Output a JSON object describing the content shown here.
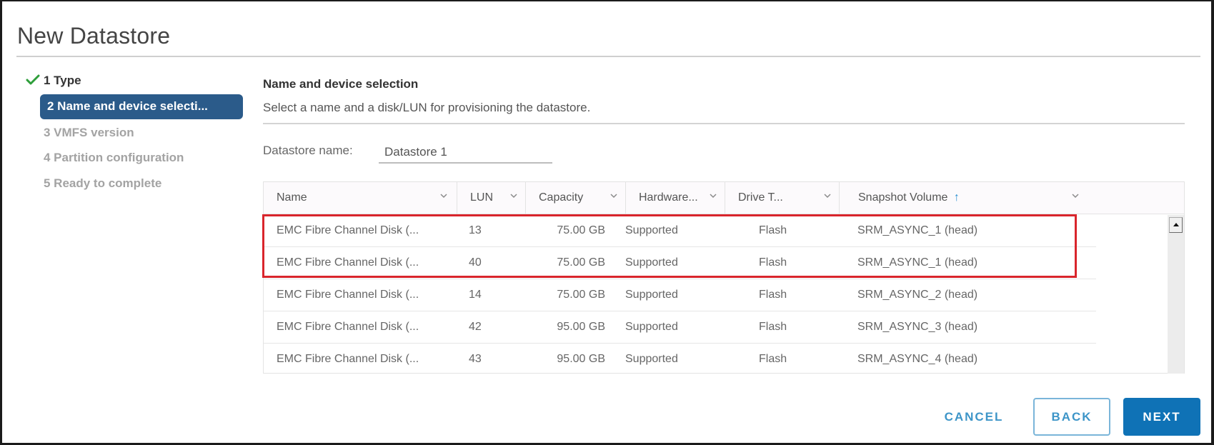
{
  "dialog": {
    "title": "New Datastore"
  },
  "wizard": {
    "steps": [
      {
        "label": "1 Type",
        "state": "completed"
      },
      {
        "label": "2 Name and device selecti...",
        "state": "active"
      },
      {
        "label": "3 VMFS version",
        "state": "pending"
      },
      {
        "label": "4 Partition configuration",
        "state": "pending"
      },
      {
        "label": "5 Ready to complete",
        "state": "pending"
      }
    ],
    "completed_icon": "checkmark-icon"
  },
  "content": {
    "heading": "Name and device selection",
    "subtitle": "Select a name and a disk/LUN for provisioning the datastore.",
    "datastore_name_label": "Datastore name:",
    "datastore_name_value": "Datastore 1"
  },
  "table": {
    "columns": [
      {
        "label": "Name"
      },
      {
        "label": "LUN"
      },
      {
        "label": "Capacity"
      },
      {
        "label": "Hardware..."
      },
      {
        "label": "Drive T..."
      },
      {
        "label": "Snapshot Volume",
        "sort": "ascending",
        "sort_icon": "arrow-up-icon"
      }
    ],
    "rows": [
      {
        "name": "EMC Fibre Channel Disk (...",
        "lun": "13",
        "capacity": "75.00 GB",
        "hardware": "Supported",
        "drive_type": "Flash",
        "snapshot_volume": "SRM_ASYNC_1 (head)",
        "highlighted": true
      },
      {
        "name": "EMC Fibre Channel Disk (...",
        "lun": "40",
        "capacity": "75.00 GB",
        "hardware": "Supported",
        "drive_type": "Flash",
        "snapshot_volume": "SRM_ASYNC_1 (head)",
        "highlighted": true
      },
      {
        "name": "EMC Fibre Channel Disk (...",
        "lun": "14",
        "capacity": "75.00 GB",
        "hardware": "Supported",
        "drive_type": "Flash",
        "snapshot_volume": "SRM_ASYNC_2 (head)",
        "highlighted": false
      },
      {
        "name": "EMC Fibre Channel Disk (...",
        "lun": "42",
        "capacity": "95.00 GB",
        "hardware": "Supported",
        "drive_type": "Flash",
        "snapshot_volume": "SRM_ASYNC_3 (head)",
        "highlighted": false
      },
      {
        "name": "EMC Fibre Channel Disk (...",
        "lun": "43",
        "capacity": "95.00 GB",
        "hardware": "Supported",
        "drive_type": "Flash",
        "snapshot_volume": "SRM_ASYNC_4 (head)",
        "highlighted": false
      }
    ],
    "highlight_color": "#d9252c"
  },
  "footer": {
    "cancel_label": "CANCEL",
    "back_label": "BACK",
    "next_label": "NEXT"
  },
  "colors": {
    "accent": "#0f72b6",
    "active_step": "#2b5b8a",
    "check": "#2e9e3a",
    "link": "#3d95c8"
  }
}
